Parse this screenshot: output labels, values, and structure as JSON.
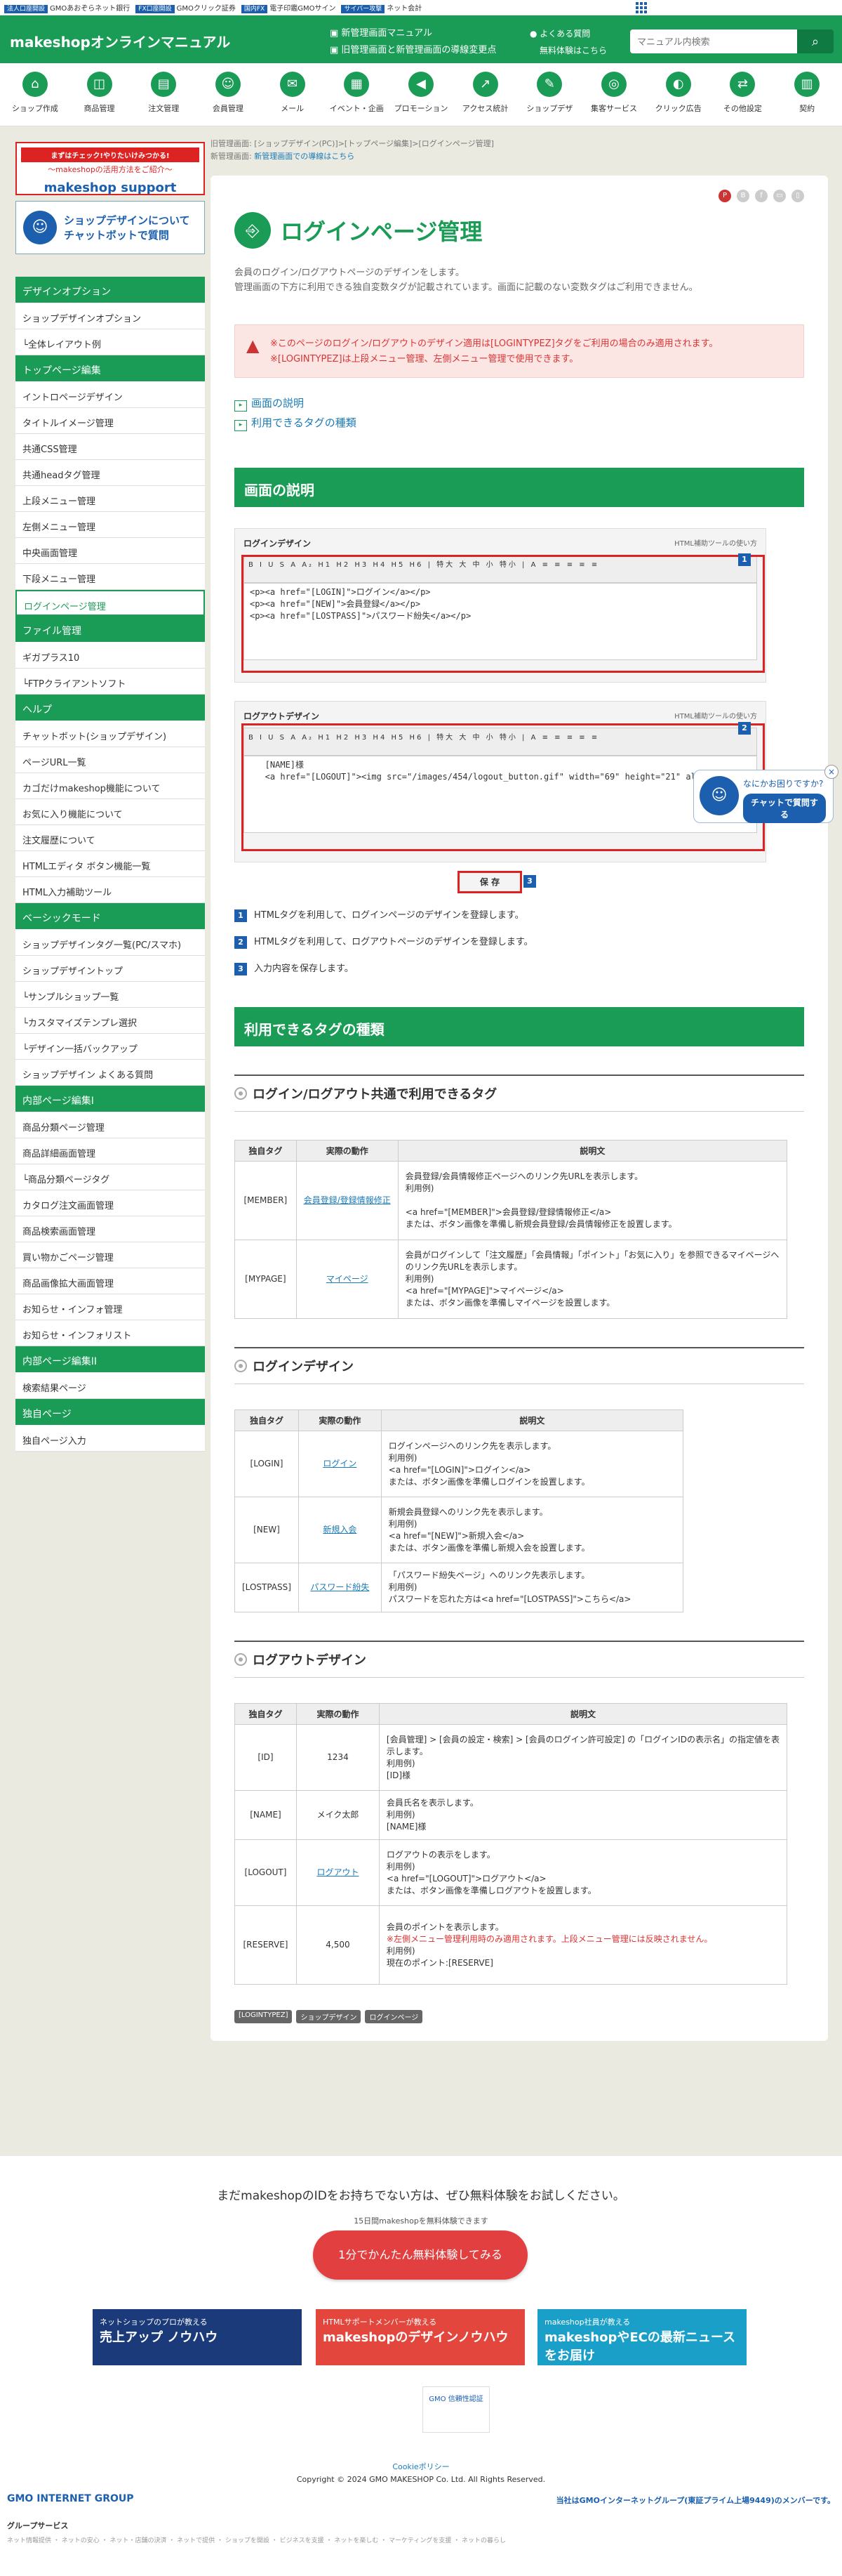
{
  "gmobar": {
    "items": [
      "GMOあおぞらネット銀行",
      "GMOクリック証券",
      "電子印鑑GMOサイン",
      "ネット会計"
    ],
    "tags": [
      "法人口座開設",
      "FX口座開設",
      "国内FX",
      "サイバー攻撃"
    ]
  },
  "header": {
    "logo": "makeshopオンラインマニュアル",
    "link1": "新管理画面マニュアル",
    "link2": "旧管理画面と新管理画面の導線変更点",
    "link3": "よくある質問",
    "link4": "無料体験はこちら",
    "search_placeholder": "マニュアル内検索"
  },
  "nav": [
    "ショップ作成",
    "商品管理",
    "注文管理",
    "会員管理",
    "メール",
    "イベント・企画",
    "プロモーション",
    "アクセス統計",
    "ショップデザ",
    "集客サービス",
    "クリック広告",
    "その他設定",
    "契約"
  ],
  "sidebar": {
    "banner1_top": "まずはチェック!やりたいけみつかる!",
    "banner1_mid": "〜makeshopの活用方法をご紹介〜",
    "banner1_brand": "makeshop support",
    "banner2": "ショップデザインについてチャットボットで質問",
    "groups": [
      {
        "title": "デザインオプション",
        "items": [
          "ショップデザインオプション",
          "└全体レイアウト例"
        ]
      },
      {
        "title": "トップページ編集",
        "items": [
          "イントロページデザイン",
          "タイトルイメージ管理",
          "共通CSS管理",
          "共通headタグ管理",
          "上段メニュー管理",
          "左側メニュー管理",
          "中央画面管理",
          "下段メニュー管理",
          "ログインページ管理"
        ]
      },
      {
        "title": "ファイル管理",
        "items": [
          "ギガプラス10",
          "└FTPクライアントソフト"
        ]
      },
      {
        "title": "ヘルプ",
        "items": [
          "チャットボット(ショップデザイン)",
          "ページURL一覧",
          "カゴだけmakeshop機能について",
          "お気に入り機能について",
          "注文履歴について",
          "HTMLエディタ ボタン機能一覧",
          "HTML入力補助ツール"
        ]
      },
      {
        "title": "ベーシックモード",
        "items": [
          "ショップデザインタグ一覧(PC/スマホ)",
          "ショップデザイントップ",
          "└サンプルショップ一覧",
          "└カスタマイズテンプレ選択",
          "└デザイン一括バックアップ",
          "ショップデザイン よくある質問"
        ]
      },
      {
        "title": "内部ページ編集I",
        "items": [
          "商品分類ページ管理",
          "商品詳細画面管理",
          "└商品分類ページタグ",
          "カタログ注文画面管理",
          "商品検索画面管理",
          "買い物かごページ管理",
          "商品画像拡大画面管理",
          "お知らせ・インフォ管理",
          "お知らせ・インフォリスト"
        ]
      },
      {
        "title": "内部ページ編集II",
        "items": [
          "検索結果ページ"
        ]
      },
      {
        "title": "独自ページ",
        "items": [
          "独自ページ入力"
        ]
      }
    ]
  },
  "breadcrumb": {
    "old_label": "旧管理画面:",
    "old_path": "[ショップデザイン(PC)]>[トップページ編集]>[ログインページ管理]",
    "new_label": "新管理画面:",
    "new_path": "新管理画面での導線はこちら"
  },
  "page": {
    "title": "ログインページ管理",
    "lead1": "会員のログイン/ログアウトページのデザインをします。",
    "lead2": "管理画面の下方に利用できる独自変数タグが記載されています。画面に記載のない変数タグはご利用できません。",
    "alert1": "※このページのログイン/ログアウトのデザイン適用は[LOGINTYPEZ]タグをご利用の場合のみ適用されます。",
    "alert2": "※[LOGINTYPEZ]は上段メニュー管理、左側メニュー管理で使用できます。",
    "toc": [
      "画面の説明",
      "利用できるタグの種類"
    ]
  },
  "sec1": {
    "title": "画面の説明",
    "login_label": "ログインデザイン",
    "logout_label": "ログアウトデザイン",
    "help": "HTML補助ツールの使い方",
    "toolbar": "B I U S A A₂ H1 H2 H3 H4 H5 H6 | 特大 大 中 小 特小 | A ≡ ≡ ≡ ≡ ≡",
    "login_code": "<p><a href=\"[LOGIN]\">ログイン</a></p>\n<p><a href=\"[NEW]\">会員登録</a></p>\n<p><a href=\"[LOSTPASS]\">パスワード紛失</a></p>",
    "logout_code": "   [NAME]様\n   <a href=\"[LOGOUT]\"><img src=\"/images/454/logout_button.gif\" width=\"69\" height=\"21\" alt=\"ログアウト\"></a>",
    "save": "保 存",
    "nums": [
      "1",
      "2",
      "3"
    ],
    "steps": [
      "HTMLタグを利用して、ログインページのデザインを登録します。",
      "HTMLタグを利用して、ログアウトページのデザインを登録します。",
      "入力内容を保存します。"
    ]
  },
  "sec2": {
    "title": "利用できるタグの種類",
    "headers": [
      "独自タグ",
      "実際の動作",
      "説明文"
    ],
    "t1": {
      "title": "ログイン/ログアウト共通で利用できるタグ",
      "rows": [
        [
          "[MEMBER]",
          "会員登録/登録情報修正",
          "会員登録/会員情報修正ページへのリンク先URLを表示します。\n利用例)\n\n<a href=\"[MEMBER]\">会員登録/登録情報修正</a>\nまたは、ボタン画像を準備し新規会員登録/会員情報修正を設置します。"
        ],
        [
          "[MYPAGE]",
          "マイページ",
          "会員がログインして「注文履歴」「会員情報」「ポイント」「お気に入り」を参照できるマイページへのリンク先URLを表示します。\n利用例)\n<a href=\"[MYPAGE]\">マイページ</a>\nまたは、ボタン画像を準備しマイページを設置します。"
        ]
      ]
    },
    "t2": {
      "title": "ログインデザイン",
      "rows": [
        [
          "[LOGIN]",
          "ログイン",
          "ログインページへのリンク先を表示します。\n利用例)\n<a href=\"[LOGIN]\">ログイン</a>\nまたは、ボタン画像を準備しログインを設置します。"
        ],
        [
          "[NEW]",
          "新規入会",
          "新規会員登録へのリンク先を表示します。\n利用例)\n<a href=\"[NEW]\">新規入会</a>\nまたは、ボタン画像を準備し新規入会を設置します。"
        ],
        [
          "[LOSTPASS]",
          "パスワード紛失",
          "「パスワード紛失ページ」へのリンク先表示します。\n利用例)\nパスワードを忘れた方は<a href=\"[LOSTPASS]\">こちら</a>"
        ]
      ]
    },
    "t3": {
      "title": "ログアウトデザイン",
      "rows": [
        [
          "[ID]",
          "1234",
          "[会員管理] > [会員の設定・検索] > [会員のログイン許可設定] の「ログインIDの表示名」の指定値を表示します。\n利用例)\n[ID]様"
        ],
        [
          "[NAME]",
          "メイク太郎",
          "会員氏名を表示します。\n利用例)\n[NAME]様"
        ],
        [
          "[LOGOUT]",
          "ログアウト",
          "ログアウトの表示をします。\n利用例)\n<a href=\"[LOGOUT]\">ログアウト</a>\nまたは、ボタン画像を準備しログアウトを設置します。"
        ],
        [
          "[RESERVE]",
          "4,500",
          "会員のポイントを表示します。\n※左側メニュー管理利用時のみ適用されます。上段メニュー管理には反映されません。\n利用例)\n現在のポイント:[RESERVE]"
        ]
      ]
    },
    "tags": [
      "[LOGINTYPEZ]",
      "ショップデザイン",
      "ログインページ"
    ]
  },
  "chat": {
    "q": "なにかお困りですか?",
    "btn": "チャットで質問する"
  },
  "cta": {
    "q": "まだmakeshopのIDをお持ちでない方は、ぜひ無料体験をお試しください。",
    "sub": "15日間makeshopを無料体験できます",
    "btn": "1分でかんたん無料体験してみる",
    "b1_small": "ネットショップのプロが教える",
    "b1": "売上アップ ノウハウ",
    "b2_small": "HTMLサポートメンバーが教える",
    "b2": "makeshopのデザインノウハウ",
    "b3_small": "makeshop社員が教える",
    "b3": "makeshopやECの最新ニュースをお届け",
    "cert": "GMO 信頼性認証"
  },
  "footer": {
    "link": "Cookieポリシー",
    "copy": "Copyright © 2024 GMO MAKESHOP Co. Ltd. All Rights Reserved.",
    "gmo": "GMO INTERNET GROUP",
    "gmo_right": "当社はGMOインターネットグループ(東証プライム上場9449)のメンバーです。",
    "gs": "グループサービス",
    "gs_list": "ネット情報提供 ・ ネットの安心 ・ ネット・店舗の決済 ・ ネットで提供 ・ ショップを開設 ・ ビジネスを支援 ・ ネットを楽しむ ・ マーケティングを支援 ・ ネットの暮らし"
  },
  "colors": {
    "brand": "#1a9c57",
    "alert": "#d33",
    "blue": "#1b5fae"
  }
}
